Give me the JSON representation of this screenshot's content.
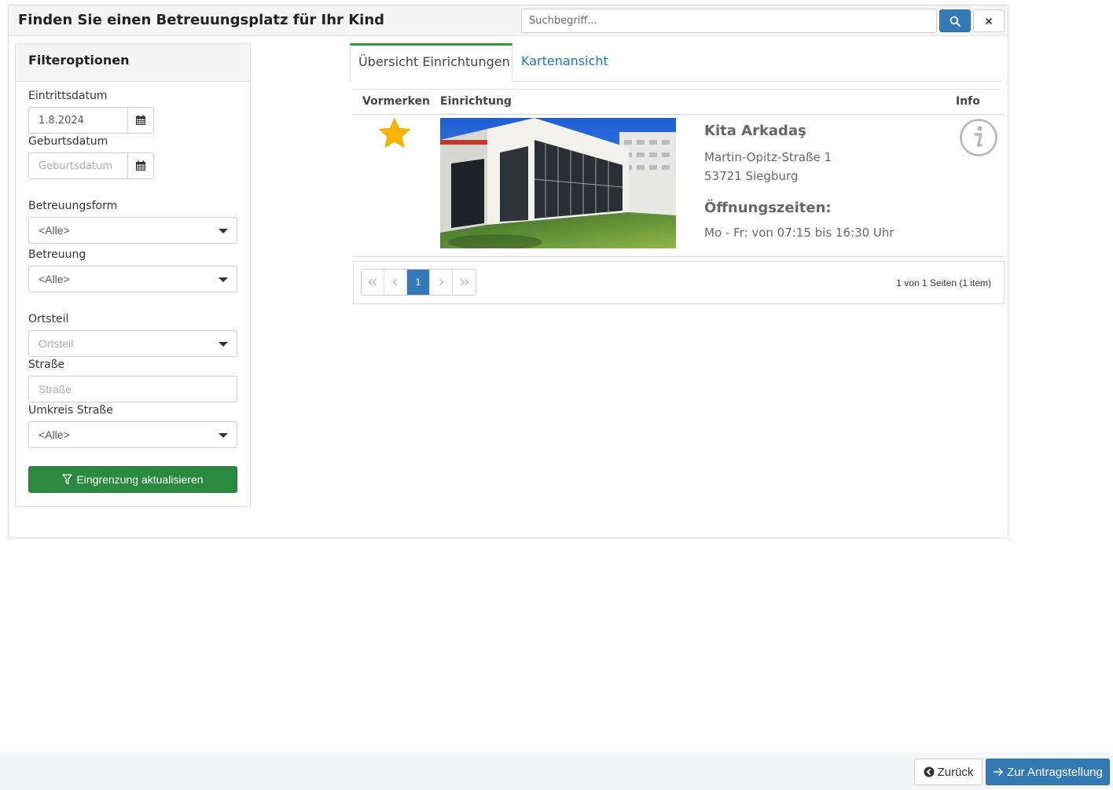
{
  "header": {
    "title": "Finden Sie einen Betreuungsplatz für Ihr Kind",
    "search_placeholder": "Suchbegriff..."
  },
  "filters": {
    "title": "Filteroptionen",
    "eintrittsdatum": {
      "label": "Eintrittsdatum",
      "value": "1.8.2024"
    },
    "geburtsdatum": {
      "label": "Geburtsdatum",
      "placeholder": "Geburtsdatum"
    },
    "betreuungsform": {
      "label": "Betreuungsform",
      "value": "<Alle>"
    },
    "betreuung": {
      "label": "Betreuung",
      "value": "<Alle>"
    },
    "ortsteil": {
      "label": "Ortsteil",
      "placeholder": "Ortsteil"
    },
    "strasse": {
      "label": "Straße",
      "placeholder": "Straße"
    },
    "umkreis": {
      "label": "Umkreis Straße",
      "value": "<Alle>"
    },
    "apply_label": "Eingrenzung aktualisieren"
  },
  "tabs": [
    {
      "label": "Übersicht Einrichtungen",
      "active": true
    },
    {
      "label": "Kartenansicht",
      "active": false
    }
  ],
  "table": {
    "columns": [
      "Vormerken",
      "Einrichtung",
      "Info"
    ],
    "rows": [
      {
        "name": "Kita Arkadaş",
        "street": "Martin-Opitz-Straße 1",
        "city": "53721 Siegburg",
        "hours_title": "Öffnungszeiten:",
        "hours": "Mo - Fr: von 07:15 bis 16:30 Uhr",
        "favorite": true
      }
    ]
  },
  "pager": {
    "current_page": "1",
    "summary": "1 von 1 Seiten (1 item)"
  },
  "footer": {
    "back_label": "Zurück",
    "next_label": "Zur Antragstellung"
  },
  "colors": {
    "primary": "#337ab7",
    "success": "#2a8a3e",
    "star": "#f7b500",
    "tab_accent": "#2a9a3e",
    "link": "#1a73c8"
  },
  "icons": {
    "search": "search-icon",
    "clear": "close-icon",
    "calendar": "calendar-icon",
    "filter": "filter-icon",
    "favorite": "star-icon",
    "info": "info-icon",
    "back": "arrow-circle-left-icon",
    "next": "arrow-right-icon"
  }
}
